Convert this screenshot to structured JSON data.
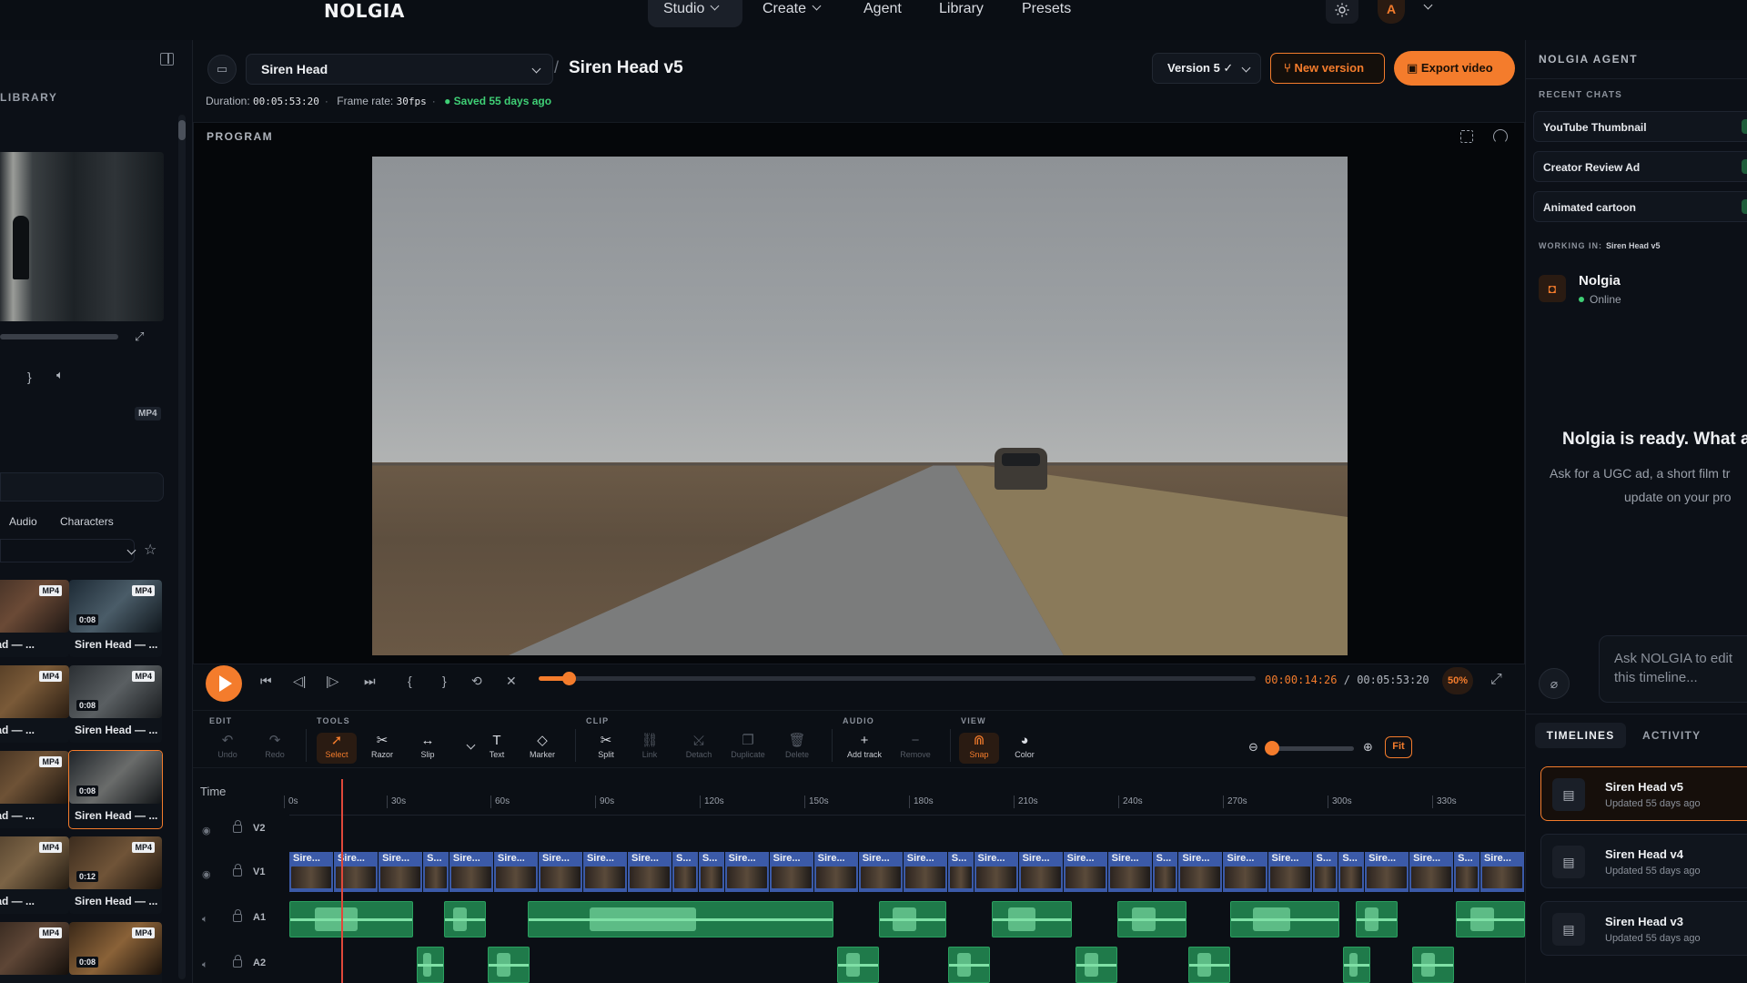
{
  "nav": {
    "logo": "NOLGIA",
    "items": [
      {
        "label": "Studio",
        "has_menu": true,
        "active": true
      },
      {
        "label": "Create",
        "has_menu": true
      },
      {
        "label": "Agent"
      },
      {
        "label": "Library"
      },
      {
        "label": "Presets"
      }
    ],
    "avatar_initial": "A",
    "theme_icon": "sun-icon"
  },
  "library": {
    "title": "LIBRARY",
    "preview_format": "MP4",
    "tabs": [
      "Audio",
      "Characters"
    ],
    "items": [
      {
        "name": "Head — ...",
        "badge": "MP4",
        "duration": ""
      },
      {
        "name": "Siren Head — ...",
        "badge": "MP4",
        "duration": "0:08"
      },
      {
        "name": "Head — ...",
        "badge": "MP4",
        "duration": ""
      },
      {
        "name": "Siren Head — ...",
        "badge": "MP4",
        "duration": "0:08"
      },
      {
        "name": "Head — ...",
        "badge": "MP4",
        "duration": ""
      },
      {
        "name": "Siren Head — ...",
        "badge": "",
        "duration": "0:08",
        "selected": true
      },
      {
        "name": "Head — ...",
        "badge": "MP4",
        "duration": ""
      },
      {
        "name": "Siren Head — ...",
        "badge": "MP4",
        "duration": "0:12"
      },
      {
        "name": "",
        "badge": "MP4",
        "duration": ""
      },
      {
        "name": "",
        "badge": "MP4",
        "duration": "0:08"
      }
    ]
  },
  "header": {
    "project": "Siren Head",
    "separator": "/",
    "version_title": "Siren Head v5",
    "duration_label": "Duration:",
    "duration": "00:05:53:20",
    "framerate_label": "Frame rate:",
    "framerate": "30fps",
    "saved": "Saved 55 days ago",
    "version_select": "Version 5 ✓",
    "new_version": "New version",
    "export": "Export video"
  },
  "program": {
    "label": "PROGRAM"
  },
  "transport": {
    "current_time": "00:00:14:26",
    "separator": "/",
    "total_time": "00:05:53:20",
    "zoom": "50%",
    "progress": 0.0435
  },
  "toolbar": {
    "groups": {
      "edit": "EDIT",
      "tools": "TOOLS",
      "clip": "CLIP",
      "audio": "AUDIO",
      "view": "VIEW"
    },
    "tools": {
      "undo": "Undo",
      "redo": "Redo",
      "select": "Select",
      "razor": "Razor",
      "slip": "Slip",
      "text": "Text",
      "marker": "Marker",
      "split": "Split",
      "link": "Link",
      "detach": "Detach",
      "duplicate": "Duplicate",
      "delete": "Delete",
      "add_track": "Add track",
      "remove": "Remove",
      "snap": "Snap",
      "color": "Color"
    },
    "fit": "Fit",
    "zoom_level": 0.0
  },
  "timeline": {
    "time_label": "Time",
    "ruler": [
      "0s",
      "30s",
      "60s",
      "90s",
      "120s",
      "150s",
      "180s",
      "210s",
      "240s",
      "270s",
      "300s",
      "330s"
    ],
    "tracks": [
      "V2",
      "V1",
      "A1",
      "A2"
    ],
    "v1_clips": [
      "Sire...",
      "Sire...",
      "Sire...",
      "S...",
      "Sire...",
      "Sire...",
      "Sire...",
      "Sire...",
      "Sire...",
      "S...",
      "S...",
      "Sire...",
      "Sire...",
      "Sire...",
      "Sire...",
      "Sire...",
      "S...",
      "Sire...",
      "Sire...",
      "Sire...",
      "Sire...",
      "S...",
      "Sire...",
      "Sire...",
      "Sire...",
      "S...",
      "S...",
      "Sire...",
      "Sire...",
      "S...",
      "Sire..."
    ]
  },
  "agent": {
    "title": "NOLGIA AGENT",
    "recent_label": "RECENT CHATS",
    "chats": [
      "YouTube Thumbnail",
      "Creator Review Ad",
      "Animated cartoon"
    ],
    "working_label": "WORKING IN:",
    "working_value": "Siren Head v5",
    "name": "Nolgia",
    "status": "Online",
    "ready_title": "Nolgia is ready. What ar",
    "ready_sub_1": "Ask for a UGC ad, a short film tr",
    "ready_sub_2": "update on your pro",
    "input_placeholder": "Ask NOLGIA to edit this timeline...",
    "tabs": {
      "timelines": "TIMELINES",
      "activity": "ACTIVITY"
    },
    "timelines": [
      {
        "name": "Siren Head v5",
        "updated": "Updated 55 days ago",
        "current": true
      },
      {
        "name": "Siren Head v4",
        "updated": "Updated 55 days ago"
      },
      {
        "name": "Siren Head v3",
        "updated": "Updated 55 days ago"
      }
    ]
  },
  "colors": {
    "accent": "#f47c2c",
    "success": "#3fcf75",
    "video_clip": "#3b5aa8",
    "audio_clip": "#1f7a4a",
    "playhead": "#e0483a"
  }
}
